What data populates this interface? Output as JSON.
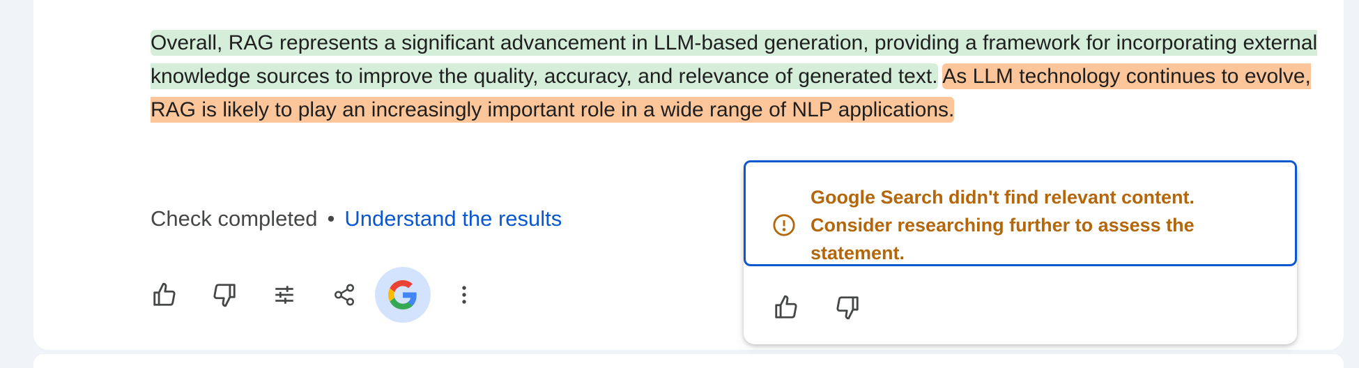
{
  "response": {
    "supported_sentence": "Overall, RAG represents a significant advancement in LLM-based generation, providing a framework for incorporating external knowledge sources to improve the quality, accuracy, and relevance of generated text.",
    "unverified_sentence": "As LLM technology continues to evolve, RAG is likely to play an increasingly important role in a wide range of NLP applications."
  },
  "check": {
    "status": "Check completed",
    "separator": "•",
    "link": "Understand the results"
  },
  "actions": {
    "icons": [
      "thumb-up-icon",
      "thumb-down-icon",
      "tune-icon",
      "share-icon",
      "google-icon",
      "more-vert-icon"
    ]
  },
  "popup": {
    "message": "Google Search didn't find relevant content. Consider researching further to assess the statement.",
    "icons": [
      "warning-circle-icon",
      "thumb-up-icon",
      "thumb-down-icon"
    ]
  },
  "colors": {
    "supported_highlight": "#d4eed9",
    "unverified_highlight": "#fdc69a",
    "link": "#0b57d0",
    "warning_text": "#b4660a",
    "selected_border": "#0b57d0"
  }
}
